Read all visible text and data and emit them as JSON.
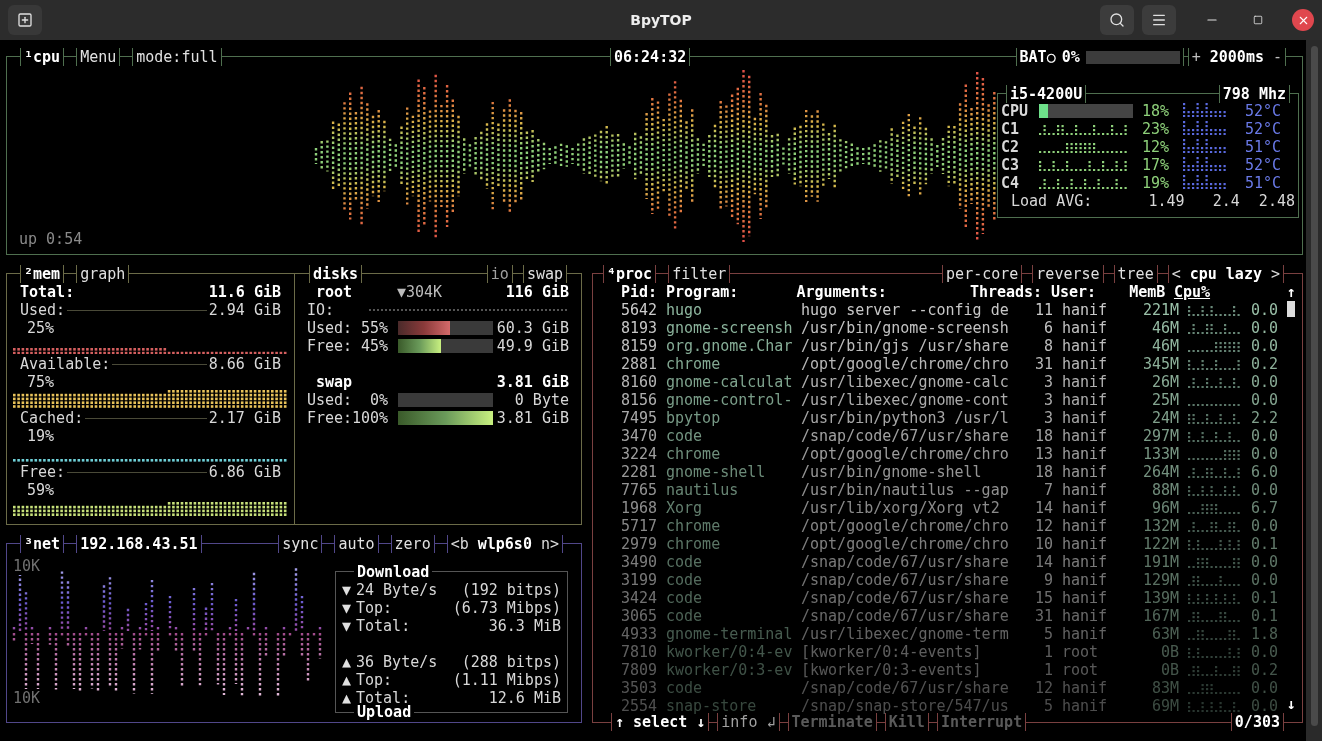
{
  "window": {
    "title": "BpyTOP"
  },
  "cpu": {
    "title": "¹cpu",
    "menu": "Menu",
    "mode": "mode:full",
    "clock": "06:24:32",
    "battery": {
      "label": "BAT○",
      "percent": "0%",
      "level": 0
    },
    "interval": {
      "plus": "+",
      "value": "2000ms",
      "minus": "-"
    },
    "uptime": "up 0:54",
    "model": "i5-4200U",
    "freq": "798 Mhz",
    "cores": [
      {
        "label": "CPU",
        "kind": "bar",
        "level": 0.1,
        "percent": "18%",
        "temp": "52°C"
      },
      {
        "label": "C1",
        "kind": "graph",
        "percent": "23%",
        "temp": "52°C"
      },
      {
        "label": "C2",
        "kind": "graph",
        "percent": "12%",
        "temp": "51°C"
      },
      {
        "label": "C3",
        "kind": "graph",
        "percent": "17%",
        "temp": "52°C"
      },
      {
        "label": "C4",
        "kind": "graph",
        "percent": "19%",
        "temp": "51°C"
      }
    ],
    "load": {
      "label": "Load AVG:",
      "values": [
        "1.49",
        "2.4",
        "2.48"
      ]
    }
  },
  "mem": {
    "title": "²mem",
    "toggle": "graph",
    "total": {
      "label": "Total:",
      "value": "11.6 GiB"
    },
    "items": [
      {
        "label": "Used:",
        "value": "2.94 GiB",
        "percent": "25%",
        "color": "#d45f5f"
      },
      {
        "label": "Available:",
        "value": "8.66 GiB",
        "percent": "75%",
        "color": "#e8c25a"
      },
      {
        "label": "Cached:",
        "value": "2.17 GiB",
        "percent": "19%",
        "color": "#6fd0d8"
      },
      {
        "label": "Free:",
        "value": "6.86 GiB",
        "percent": "59%",
        "color": "#c6e07a"
      }
    ]
  },
  "disks": {
    "title": "disks",
    "io": "io",
    "swap": "swap",
    "devices": [
      {
        "name": "root",
        "io": "▼304K",
        "size": "116 GiB",
        "io_label": "IO:",
        "rows": [
          {
            "label": "Used:",
            "percent": "55%",
            "level": 0.55,
            "value": "60.3 GiB",
            "kind": "used"
          },
          {
            "label": "Free:",
            "percent": "45%",
            "level": 0.45,
            "value": "49.9 GiB",
            "kind": "free"
          }
        ]
      },
      {
        "name": "swap",
        "size": "3.81 GiB",
        "rows": [
          {
            "label": "Used:",
            "percent": "0%",
            "level": 0,
            "value": "0 Byte",
            "kind": "used"
          },
          {
            "label": "Free:",
            "percent": "100%",
            "level": 1,
            "value": "3.81 GiB",
            "kind": "free"
          }
        ]
      }
    ]
  },
  "net": {
    "title": "³net",
    "ip": "192.168.43.51",
    "buttons": [
      "sync",
      "auto",
      "zero"
    ],
    "interface": {
      "prev": "<b",
      "name": "wlp6s0",
      "next": "n>"
    },
    "scale_top": "10K",
    "scale_bottom": "10K",
    "download": {
      "title": "Download",
      "arrow": "▼",
      "rows": [
        {
          "label": "24 Byte/s",
          "value": "(192 bitps)"
        },
        {
          "label": "Top:",
          "value": "(6.73 Mibps)"
        },
        {
          "label": "Total:",
          "value": "36.3 MiB"
        }
      ]
    },
    "upload": {
      "title": "Upload",
      "arrow": "▲",
      "rows": [
        {
          "label": "36 Byte/s",
          "value": "(288 bitps)"
        },
        {
          "label": "Top:",
          "value": "(1.11 Mibps)"
        },
        {
          "label": "Total:",
          "value": "12.6 MiB"
        }
      ]
    }
  },
  "proc": {
    "title": "⁴proc",
    "filter": "filter",
    "options": [
      "per-core",
      "reverse",
      "tree"
    ],
    "sort": {
      "prev": "<",
      "name": "cpu lazy",
      "next": ">"
    },
    "columns": [
      {
        "label": "Pid:",
        "selected": false
      },
      {
        "label": "Program:",
        "selected": false
      },
      {
        "label": "Arguments:",
        "selected": false
      },
      {
        "label": "Threads:",
        "selected": false
      },
      {
        "label": "User:",
        "selected": false
      },
      {
        "label": "MemB",
        "selected": false
      },
      {
        "label": "Cpu%",
        "selected": true
      }
    ],
    "rows": [
      {
        "pid": "5642",
        "program": "hugo",
        "args": "hugo server --config de",
        "threads": "11",
        "user": "hanif",
        "mem": "221M",
        "cpu": "0.0"
      },
      {
        "pid": "8193",
        "program": "gnome-screensh",
        "args": "/usr/bin/gnome-screensh",
        "threads": "6",
        "user": "hanif",
        "mem": "46M",
        "cpu": "0.0"
      },
      {
        "pid": "8159",
        "program": "org.gnome.Char",
        "args": "/usr/bin/gjs /usr/share",
        "threads": "8",
        "user": "hanif",
        "mem": "46M",
        "cpu": "0.0"
      },
      {
        "pid": "2881",
        "program": "chrome",
        "args": "/opt/google/chrome/chro",
        "threads": "31",
        "user": "hanif",
        "mem": "345M",
        "cpu": "0.2"
      },
      {
        "pid": "8160",
        "program": "gnome-calculat",
        "args": "/usr/libexec/gnome-calc",
        "threads": "3",
        "user": "hanif",
        "mem": "26M",
        "cpu": "0.0"
      },
      {
        "pid": "8156",
        "program": "gnome-control-",
        "args": "/usr/libexec/gnome-cont",
        "threads": "3",
        "user": "hanif",
        "mem": "25M",
        "cpu": "0.0"
      },
      {
        "pid": "7495",
        "program": "bpytop",
        "args": "/usr/bin/python3 /usr/l",
        "threads": "3",
        "user": "hanif",
        "mem": "24M",
        "cpu": "2.2"
      },
      {
        "pid": "3470",
        "program": "code",
        "args": "/snap/code/67/usr/share",
        "threads": "18",
        "user": "hanif",
        "mem": "297M",
        "cpu": "0.0"
      },
      {
        "pid": "3224",
        "program": "chrome",
        "args": "/opt/google/chrome/chro",
        "threads": "13",
        "user": "hanif",
        "mem": "133M",
        "cpu": "0.0"
      },
      {
        "pid": "2281",
        "program": "gnome-shell",
        "args": "/usr/bin/gnome-shell",
        "threads": "18",
        "user": "hanif",
        "mem": "264M",
        "cpu": "6.0"
      },
      {
        "pid": "7765",
        "program": "nautilus",
        "args": "/usr/bin/nautilus --gap",
        "threads": "7",
        "user": "hanif",
        "mem": "88M",
        "cpu": "0.0"
      },
      {
        "pid": "1968",
        "program": "Xorg",
        "args": "/usr/lib/xorg/Xorg vt2",
        "threads": "14",
        "user": "hanif",
        "mem": "96M",
        "cpu": "6.7"
      },
      {
        "pid": "5717",
        "program": "chrome",
        "args": "/opt/google/chrome/chro",
        "threads": "12",
        "user": "hanif",
        "mem": "132M",
        "cpu": "0.0"
      },
      {
        "pid": "2979",
        "program": "chrome",
        "args": "/opt/google/chrome/chro",
        "threads": "10",
        "user": "hanif",
        "mem": "122M",
        "cpu": "0.1"
      },
      {
        "pid": "3490",
        "program": "code",
        "args": "/snap/code/67/usr/share",
        "threads": "14",
        "user": "hanif",
        "mem": "191M",
        "cpu": "0.0"
      },
      {
        "pid": "3199",
        "program": "code",
        "args": "/snap/code/67/usr/share",
        "threads": "9",
        "user": "hanif",
        "mem": "129M",
        "cpu": "0.0"
      },
      {
        "pid": "3424",
        "program": "code",
        "args": "/snap/code/67/usr/share",
        "threads": "15",
        "user": "hanif",
        "mem": "139M",
        "cpu": "0.1"
      },
      {
        "pid": "3065",
        "program": "code",
        "args": "/snap/code/67/usr/share",
        "threads": "31",
        "user": "hanif",
        "mem": "167M",
        "cpu": "0.1"
      },
      {
        "pid": "4933",
        "program": "gnome-terminal",
        "args": "/usr/libexec/gnome-term",
        "threads": "5",
        "user": "hanif",
        "mem": "63M",
        "cpu": "1.8"
      },
      {
        "pid": "7810",
        "program": "kworker/0:4-ev",
        "args": "[kworker/0:4-events]",
        "threads": "1",
        "user": "root",
        "mem": "0B",
        "cpu": "0.0"
      },
      {
        "pid": "7809",
        "program": "kworker/0:3-ev",
        "args": "[kworker/0:3-events]",
        "threads": "1",
        "user": "root",
        "mem": "0B",
        "cpu": "0.2"
      },
      {
        "pid": "3503",
        "program": "code",
        "args": "/snap/code/67/usr/share",
        "threads": "12",
        "user": "hanif",
        "mem": "83M",
        "cpu": "0.0"
      },
      {
        "pid": "2554",
        "program": "snap-store",
        "args": "/snap/snap-store/547/us",
        "threads": "5",
        "user": "hanif",
        "mem": "69M",
        "cpu": "0.0"
      }
    ],
    "scroll_up": "↑",
    "scroll_down": "↓",
    "footer": {
      "select": "↑ select ↓",
      "info": "info ↲",
      "actions": [
        "Terminate",
        "Kill",
        "Interrupt"
      ],
      "count": "0/303"
    }
  }
}
